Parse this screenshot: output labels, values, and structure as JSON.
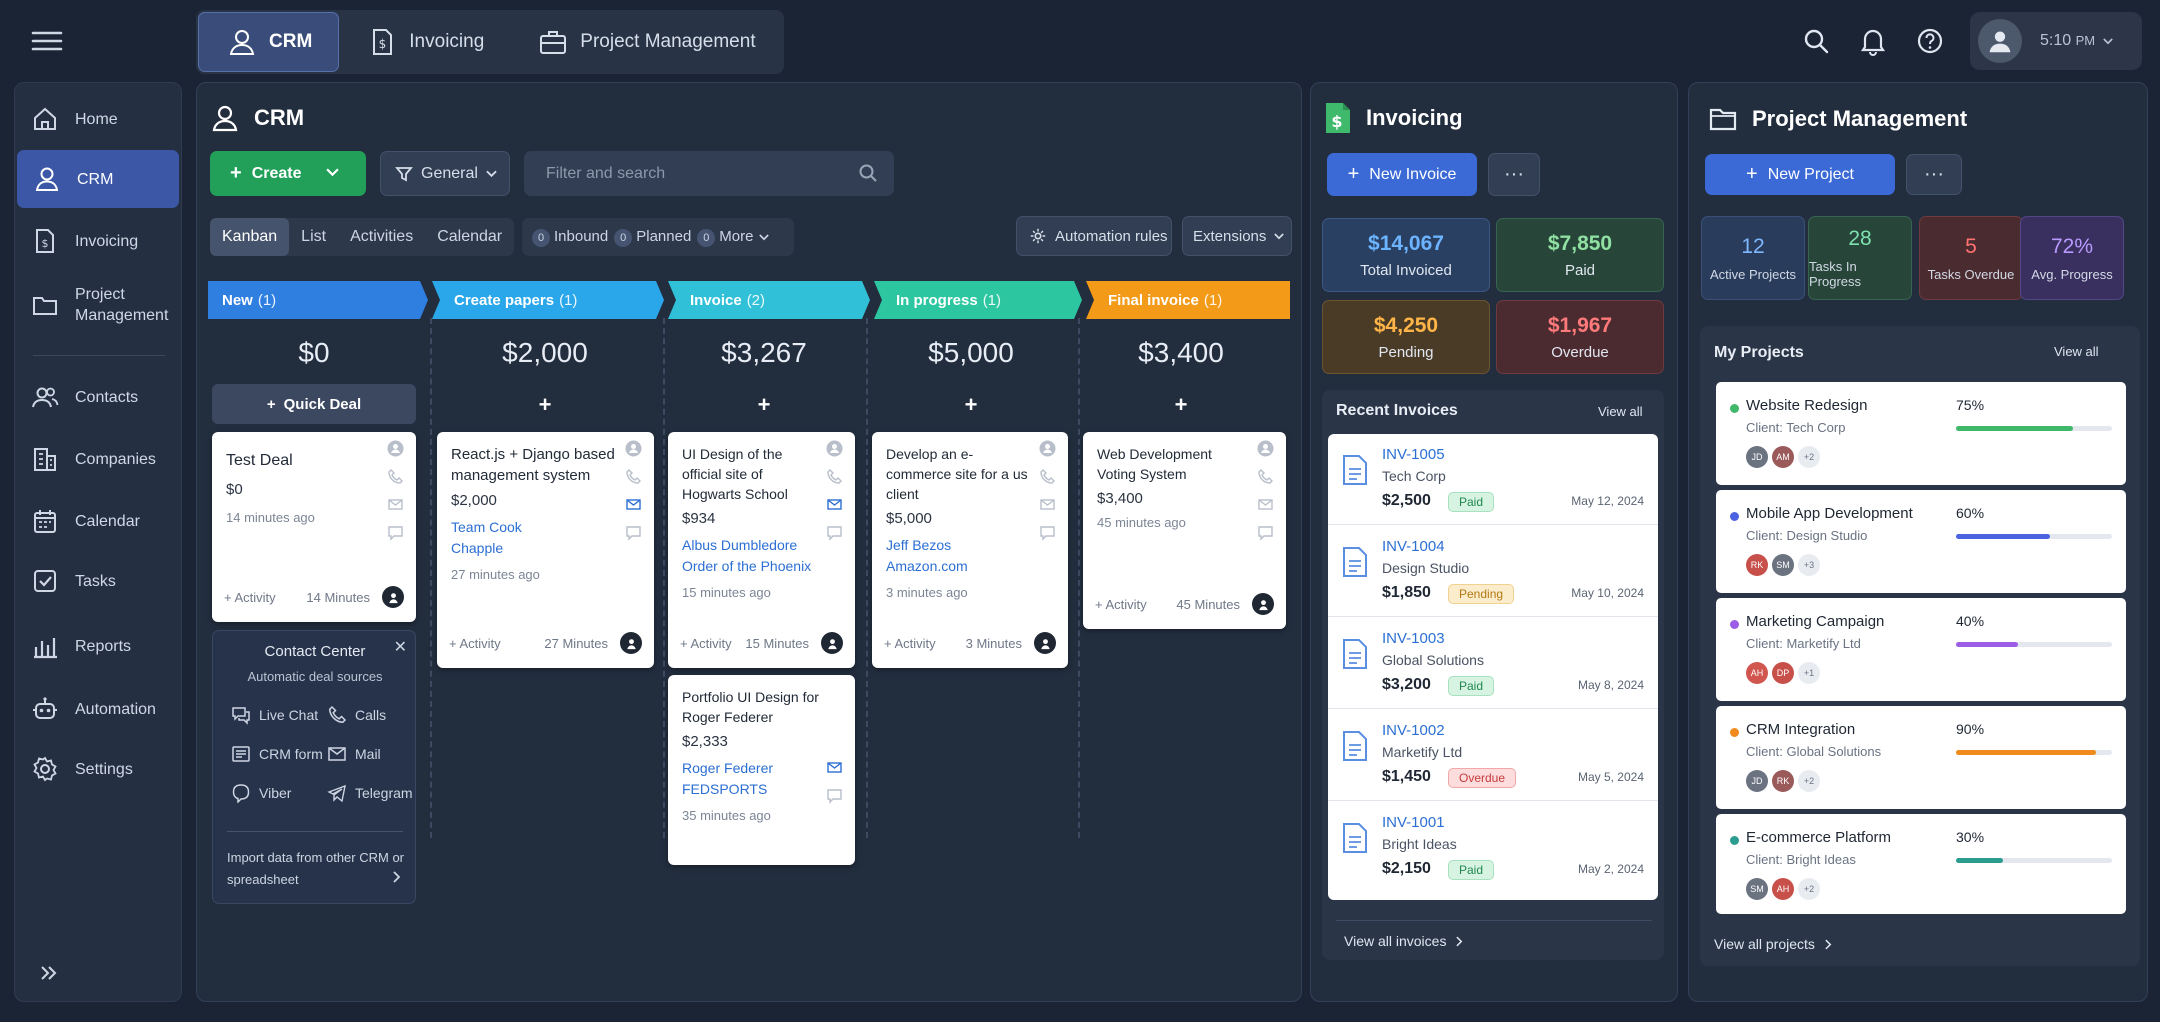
{
  "topbar": {
    "tabs": [
      {
        "label": "CRM",
        "icon": "user-icon"
      },
      {
        "label": "Invoicing",
        "icon": "invoice-icon"
      },
      {
        "label": "Project Management",
        "icon": "briefcase-icon"
      }
    ],
    "time": "5:10",
    "time_suffix": "PM",
    "icons": [
      "search-icon",
      "bell-icon",
      "help-icon"
    ]
  },
  "sidebar": {
    "items": [
      {
        "label": "Home",
        "icon": "home-icon"
      },
      {
        "label": "CRM",
        "icon": "user-icon"
      },
      {
        "label": "Invoicing",
        "icon": "invoice-icon"
      },
      {
        "label": "Project Management",
        "icon": "folder-icon"
      },
      {
        "label": "Contacts",
        "icon": "contacts-icon"
      },
      {
        "label": "Companies",
        "icon": "building-icon"
      },
      {
        "label": "Calendar",
        "icon": "calendar-icon"
      },
      {
        "label": "Tasks",
        "icon": "checkbox-icon"
      },
      {
        "label": "Reports",
        "icon": "bar-chart-icon"
      },
      {
        "label": "Automation",
        "icon": "robot-icon"
      },
      {
        "label": "Settings",
        "icon": "gear-icon"
      }
    ]
  },
  "crm": {
    "title": "CRM",
    "create_label": "Create",
    "general_label": "General",
    "search_placeholder": "Filter and search",
    "view_tabs": [
      "Kanban",
      "List",
      "Activities",
      "Calendar"
    ],
    "chips": {
      "inbound_count": "0",
      "inbound": "Inbound",
      "planned_count": "0",
      "planned": "Planned",
      "more_count": "0",
      "more": "More"
    },
    "automation_label": "Automation rules",
    "extensions_label": "Extensions",
    "quick_deal": "Quick Deal",
    "columns": [
      {
        "name": "New",
        "count": "(1)",
        "total": "$0",
        "color": "#2f7fe0"
      },
      {
        "name": "Create papers",
        "count": "(1)",
        "total": "$2,000",
        "color": "#2aa7ea"
      },
      {
        "name": "Invoice",
        "count": "(2)",
        "total": "$3,267",
        "color": "#30c0d8"
      },
      {
        "name": "In progress",
        "count": "(1)",
        "total": "$5,000",
        "color": "#2cc7a0"
      },
      {
        "name": "Final invoice",
        "count": "(1)",
        "total": "$3,400",
        "color": "#f39a18"
      }
    ],
    "cards": [
      {
        "title": "Test Deal",
        "amount": "$0",
        "time": "14 minutes ago",
        "activity": "+ Activity",
        "duration": "14 Minutes"
      },
      {
        "title": "React.js + Django based management system",
        "amount": "$2,000",
        "contact": "Team Cook",
        "company": "Chapple",
        "time": "27 minutes ago",
        "activity": "+ Activity",
        "duration": "27 Minutes"
      },
      {
        "title": "UI Design of the official site of Hogwarts School",
        "amount": "$934",
        "contact": "Albus Dumbledore",
        "company": "Order of the Phoenix",
        "time": "15 minutes ago",
        "activity": "+ Activity",
        "duration": "15 Minutes"
      },
      {
        "title": "Portfolio UI Design for Roger Federer",
        "amount": "$2,333",
        "contact": "Roger Federer",
        "company": "FEDSPORTS",
        "time": "35 minutes ago"
      },
      {
        "title": "Develop an e-commerce site for a us client",
        "amount": "$5,000",
        "contact": "Jeff Bezos",
        "company": "Amazon.com",
        "time": "3 minutes ago",
        "activity": "+ Activity",
        "duration": "3 Minutes"
      },
      {
        "title": "Web Development Voting System",
        "amount": "$3,400",
        "time": "45 minutes ago",
        "activity": "+ Activity",
        "duration": "45 Minutes"
      }
    ],
    "contact_center": {
      "title": "Contact Center",
      "subtitle": "Automatic deal sources",
      "items": [
        {
          "label": "Live Chat",
          "icon": "chat-icon"
        },
        {
          "label": "Calls",
          "icon": "phone-icon"
        },
        {
          "label": "CRM form",
          "icon": "form-icon"
        },
        {
          "label": "Mail",
          "icon": "mail-icon"
        },
        {
          "label": "Viber",
          "icon": "viber-icon"
        },
        {
          "label": "Telegram",
          "icon": "telegram-icon"
        }
      ],
      "import_line1": "Import data from other CRM or",
      "import_line2": "spreadsheet"
    }
  },
  "invoicing": {
    "title": "Invoicing",
    "new_label": "New Invoice",
    "stats": [
      {
        "value": "$14,067",
        "label": "Total Invoiced",
        "color": "#6cb4ff"
      },
      {
        "value": "$7,850",
        "label": "Paid",
        "color": "#8fe0a2"
      },
      {
        "value": "$4,250",
        "label": "Pending",
        "color": "#ffb547"
      },
      {
        "value": "$1,967",
        "label": "Overdue",
        "color": "#ff7a7a"
      }
    ],
    "recent_title": "Recent Invoices",
    "view_all": "View all",
    "invoices": [
      {
        "number": "INV-1005",
        "client": "Tech Corp",
        "amount": "$2,500",
        "status": "Paid",
        "date": "May 12, 2024"
      },
      {
        "number": "INV-1004",
        "client": "Design Studio",
        "amount": "$1,850",
        "status": "Pending",
        "date": "May 10, 2024"
      },
      {
        "number": "INV-1003",
        "client": "Global Solutions",
        "amount": "$3,200",
        "status": "Paid",
        "date": "May 8, 2024"
      },
      {
        "number": "INV-1002",
        "client": "Marketify Ltd",
        "amount": "$1,450",
        "status": "Overdue",
        "date": "May 5, 2024"
      },
      {
        "number": "INV-1001",
        "client": "Bright Ideas",
        "amount": "$2,150",
        "status": "Paid",
        "date": "May 2, 2024"
      }
    ],
    "view_all_invoices": "View all invoices"
  },
  "projects": {
    "title": "Project Management",
    "new_label": "New Project",
    "stats": [
      {
        "value": "12",
        "label": "Active Projects",
        "color": "#7fb8ff"
      },
      {
        "value": "28",
        "label": "Tasks In Progress",
        "color": "#7fe0b0"
      },
      {
        "value": "5",
        "label": "Tasks Overdue",
        "color": "#ff7272"
      },
      {
        "value": "72%",
        "label": "Avg. Progress",
        "color": "#b99aff"
      }
    ],
    "my_projects": "My Projects",
    "view_all": "View all",
    "items": [
      {
        "name": "Website Redesign",
        "client": "Client: Tech Corp",
        "progress": 0.75,
        "pct": "75%",
        "color": "#3fb86a",
        "avatars": [
          "JD",
          "AM"
        ],
        "more": "+2"
      },
      {
        "name": "Mobile App Development",
        "client": "Client: Design Studio",
        "progress": 0.6,
        "pct": "60%",
        "color": "#4b63e0",
        "avatars": [
          "RK",
          "SM"
        ],
        "more": "+3"
      },
      {
        "name": "Marketing Campaign",
        "client": "Client: Marketify Ltd",
        "progress": 0.4,
        "pct": "40%",
        "color": "#9b5de5",
        "avatars": [
          "AH",
          "DP"
        ],
        "more": "+1"
      },
      {
        "name": "CRM Integration",
        "client": "Client: Global Solutions",
        "progress": 0.9,
        "pct": "90%",
        "color": "#f08a1c",
        "avatars": [
          "JD",
          "RK"
        ],
        "more": "+2"
      },
      {
        "name": "E-commerce Platform",
        "client": "Client: Bright Ideas",
        "progress": 0.3,
        "pct": "30%",
        "color": "#2a9d8f",
        "avatars": [
          "SM",
          "AH"
        ],
        "more": "+2"
      }
    ],
    "view_all_projects": "View all projects"
  }
}
